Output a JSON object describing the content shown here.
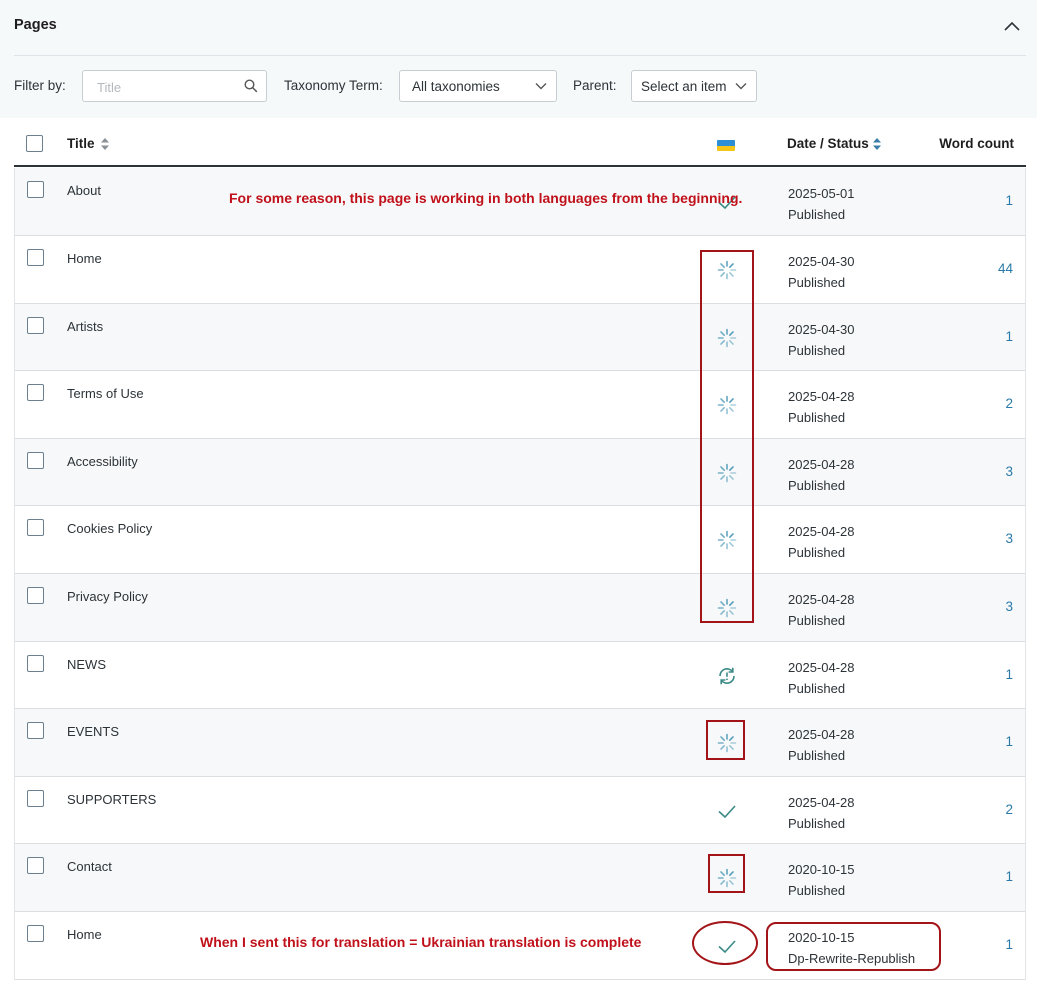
{
  "panel": {
    "title": "Pages"
  },
  "filters": {
    "filter_by_label": "Filter by:",
    "search_placeholder": "Title",
    "taxonomy_label": "Taxonomy Term:",
    "taxonomy_value": "All taxonomies",
    "parent_label": "Parent:",
    "parent_value": "Select an item"
  },
  "table": {
    "columns": {
      "title": "Title",
      "language_flag": "ukraine-flag",
      "date_status": "Date / Status",
      "word_count": "Word count"
    },
    "rows": [
      {
        "title": "About",
        "status_icon": "check-icon",
        "date": "2025-05-01",
        "status": "Published",
        "word_count": "1"
      },
      {
        "title": "Home",
        "status_icon": "spinner-icon",
        "date": "2025-04-30",
        "status": "Published",
        "word_count": "44"
      },
      {
        "title": "Artists",
        "status_icon": "spinner-icon",
        "date": "2025-04-30",
        "status": "Published",
        "word_count": "1"
      },
      {
        "title": "Terms of Use",
        "status_icon": "spinner-icon",
        "date": "2025-04-28",
        "status": "Published",
        "word_count": "2"
      },
      {
        "title": "Accessibility",
        "status_icon": "spinner-icon",
        "date": "2025-04-28",
        "status": "Published",
        "word_count": "3"
      },
      {
        "title": "Cookies Policy",
        "status_icon": "spinner-icon",
        "date": "2025-04-28",
        "status": "Published",
        "word_count": "3"
      },
      {
        "title": "Privacy Policy",
        "status_icon": "spinner-icon",
        "date": "2025-04-28",
        "status": "Published",
        "word_count": "3"
      },
      {
        "title": "NEWS",
        "status_icon": "refresh-icon",
        "date": "2025-04-28",
        "status": "Published",
        "word_count": "1"
      },
      {
        "title": "EVENTS",
        "status_icon": "spinner-icon",
        "date": "2025-04-28",
        "status": "Published",
        "word_count": "1"
      },
      {
        "title": "SUPPORTERS",
        "status_icon": "check-icon",
        "date": "2025-04-28",
        "status": "Published",
        "word_count": "2"
      },
      {
        "title": "Contact",
        "status_icon": "spinner-icon",
        "date": "2020-10-15",
        "status": "Published",
        "word_count": "1"
      },
      {
        "title": "Home",
        "status_icon": "check-icon",
        "date": "2020-10-15",
        "status": "Dp-Rewrite-Republish",
        "word_count": "1"
      }
    ]
  },
  "annotations": {
    "note_1": "For some reason, this page is working in both languages from the beginning.",
    "note_2": "When I sent this for translation = Ukrainian translation is complete",
    "color": "#c0111b"
  },
  "colors": {
    "accent_link": "#2a7aa8",
    "icon_teal": "#3a8a9a",
    "annotation_red": "#a31418"
  }
}
